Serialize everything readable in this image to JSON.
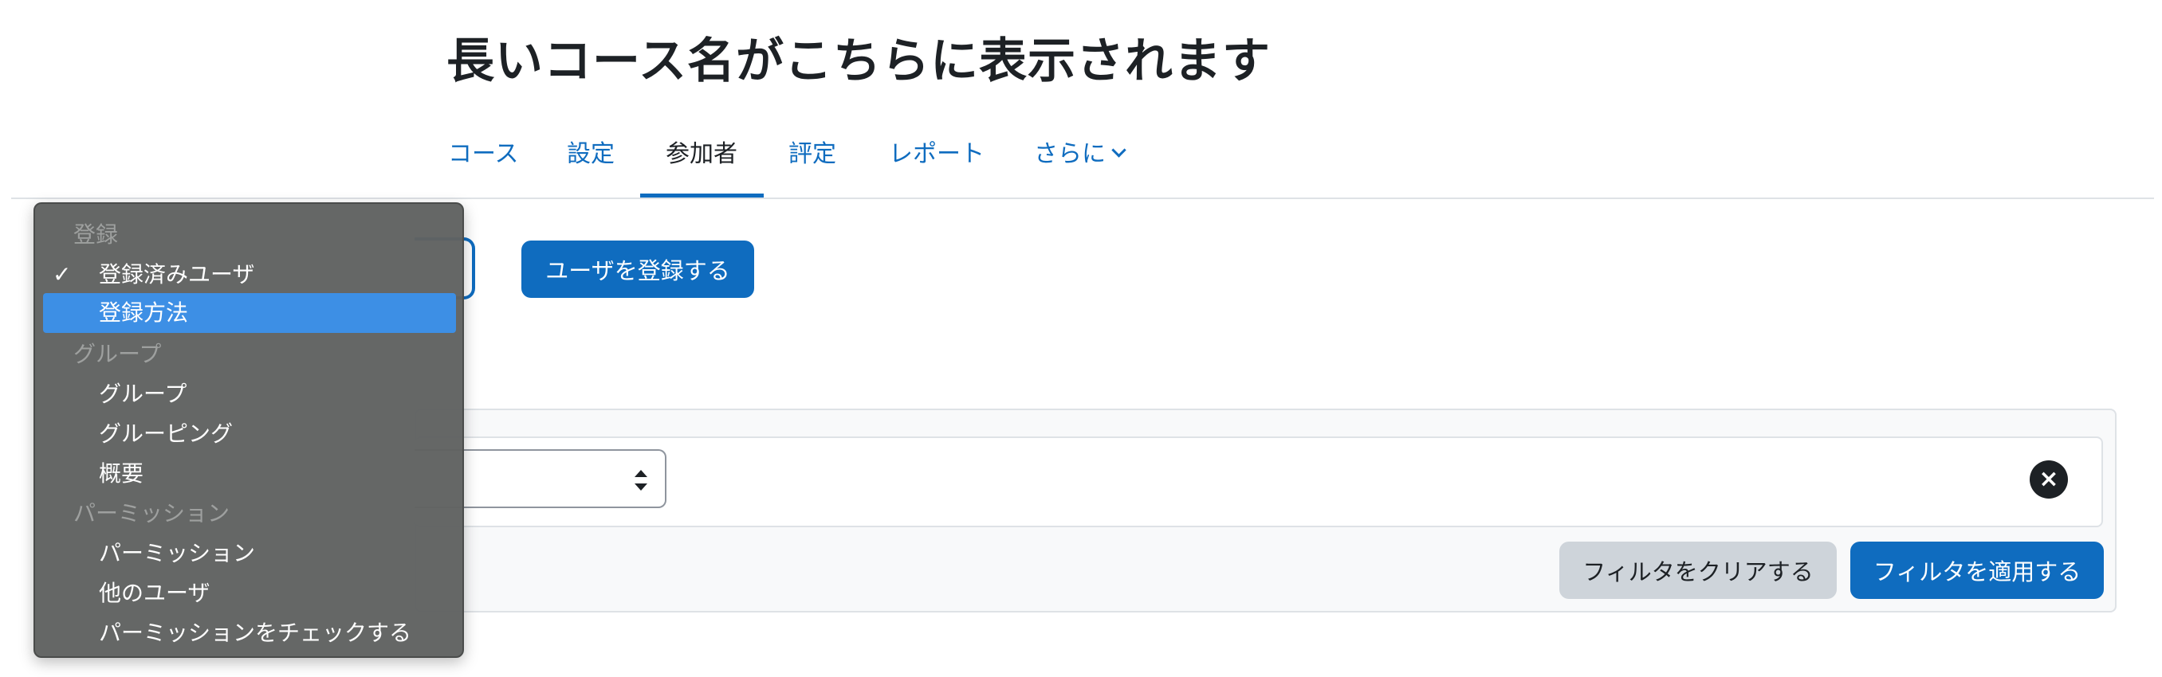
{
  "page": {
    "title": "長いコース名がこちらに表示されます"
  },
  "nav": {
    "tabs": [
      {
        "label": "コース"
      },
      {
        "label": "設定"
      },
      {
        "label": "参加者"
      },
      {
        "label": "評定"
      },
      {
        "label": "レポート"
      },
      {
        "label": "さらに"
      }
    ],
    "active_tab": "参加者"
  },
  "actions": {
    "enrol_button": "ユーザを登録する"
  },
  "filters": {
    "clear_button": "フィルタをクリアする",
    "apply_button": "フィルタを適用する",
    "remove_icon": "×"
  },
  "dropdown": {
    "groups": [
      {
        "label": "登録",
        "options": [
          {
            "label": "登録済みユーザ",
            "checked": true
          },
          {
            "label": "登録方法",
            "highlighted": true
          }
        ]
      },
      {
        "label": "グループ",
        "options": [
          {
            "label": "グループ"
          },
          {
            "label": "グルーピング"
          },
          {
            "label": "概要"
          }
        ]
      },
      {
        "label": "パーミッション",
        "options": [
          {
            "label": "パーミッション"
          },
          {
            "label": "他のユーザ"
          },
          {
            "label": "パーミッションをチェックする"
          }
        ]
      }
    ],
    "check_icon": "✓"
  },
  "colors": {
    "primary": "#0f6cbf",
    "highlight": "#3d8fe5",
    "dropdown_bg": "#606261",
    "secondary_button": "#ced4da"
  }
}
